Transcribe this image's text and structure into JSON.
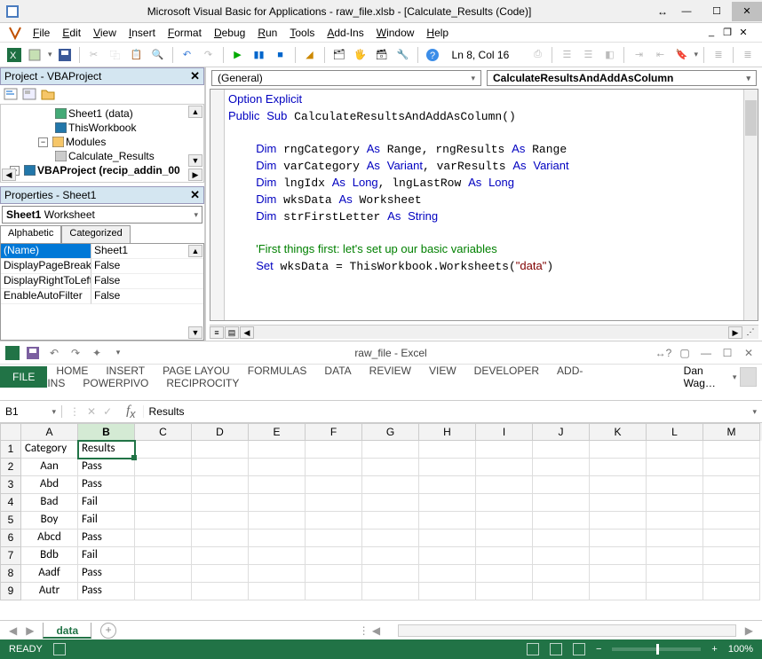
{
  "vba": {
    "title": "Microsoft Visual Basic for Applications - raw_file.xlsb - [Calculate_Results (Code)]",
    "menu": [
      "File",
      "Edit",
      "View",
      "Insert",
      "Format",
      "Debug",
      "Run",
      "Tools",
      "Add-Ins",
      "Window",
      "Help"
    ],
    "cursor_pos": "Ln 8, Col 16",
    "project": {
      "title": "Project - VBAProject",
      "items": [
        {
          "label": "Sheet1 (data)",
          "indent": 2,
          "icon": "sheet"
        },
        {
          "label": "ThisWorkbook",
          "indent": 2,
          "icon": "workbook"
        },
        {
          "label": "Modules",
          "indent": 1,
          "icon": "folder",
          "expandable": true,
          "expanded": true
        },
        {
          "label": "Calculate_Results",
          "indent": 2,
          "icon": "module"
        },
        {
          "label": "VBAProject (recip_addin_00",
          "indent": 0,
          "icon": "project",
          "expandable": true,
          "expanded": false,
          "bold": true
        }
      ]
    },
    "properties": {
      "title": "Properties - Sheet1",
      "object": "Sheet1",
      "type": "Worksheet",
      "tabs": [
        "Alphabetic",
        "Categorized"
      ],
      "active_tab": 0,
      "rows": [
        {
          "k": "(Name)",
          "v": "Sheet1",
          "sel": true
        },
        {
          "k": "DisplayPageBreaks",
          "v": "False"
        },
        {
          "k": "DisplayRightToLeft",
          "v": "False"
        },
        {
          "k": "EnableAutoFilter",
          "v": "False"
        }
      ]
    },
    "code": {
      "object_combo": "(General)",
      "proc_combo": "CalculateResultsAndAddAsColumn",
      "lines": [
        {
          "t": "Option Explicit",
          "k": [
            0,
            15
          ]
        },
        {
          "raw": "<span class=\"kw\">Public</span> <span class=\"kw\">Sub</span> CalculateResultsAndAddAsColumn()"
        },
        {
          "t": ""
        },
        {
          "raw": "    <span class=\"kw\">Dim</span> rngCategory <span class=\"kw\">As</span> Range, rngResults <span class=\"kw\">As</span> Range"
        },
        {
          "raw": "    <span class=\"kw\">Dim</span> varCategory <span class=\"kw\">As</span> <span class=\"kw\">Variant</span>, varResults <span class=\"kw\">As</span> <span class=\"kw\">Variant</span>"
        },
        {
          "raw": "    <span class=\"kw\">Dim</span> lngIdx <span class=\"kw\">As</span> <span class=\"kw\">Long</span>, lngLastRow <span class=\"kw\">As</span> <span class=\"kw\">Long</span>"
        },
        {
          "raw": "    <span class=\"kw\">Dim</span> wksData <span class=\"kw\">As</span> Worksheet"
        },
        {
          "raw": "    <span class=\"kw\">Dim</span> strFirstLetter <span class=\"kw\">As</span> <span class=\"kw\">String</span>"
        },
        {
          "t": ""
        },
        {
          "raw": "    <span class=\"cm\">'First things first: let's set up our basic variables</span>"
        },
        {
          "raw": "    <span class=\"kw\">Set</span> wksData = ThisWorkbook.Worksheets(<span class=\"str\">\"data\"</span>)"
        }
      ]
    }
  },
  "excel": {
    "qat_title": "raw_file - Excel",
    "tabs": [
      "HOME",
      "INSERT",
      "PAGE LAYOU",
      "FORMULAS",
      "DATA",
      "REVIEW",
      "VIEW",
      "DEVELOPER",
      "ADD-INS",
      "POWERPIVO",
      "RECIPROCITY"
    ],
    "file_label": "FILE",
    "user": "Dan Wag…",
    "name_box": "B1",
    "formula_bar": "Results",
    "columns": [
      "A",
      "B",
      "C",
      "D",
      "E",
      "F",
      "G",
      "H",
      "I",
      "J",
      "K",
      "L",
      "M"
    ],
    "selected_col": 1,
    "selected_cell": {
      "r": 0,
      "c": 1
    },
    "rows": [
      [
        "Category",
        "Results",
        "",
        "",
        "",
        "",
        "",
        "",
        "",
        "",
        "",
        "",
        ""
      ],
      [
        "Aan",
        "Pass",
        "",
        "",
        "",
        "",
        "",
        "",
        "",
        "",
        "",
        "",
        ""
      ],
      [
        "Abd",
        "Pass",
        "",
        "",
        "",
        "",
        "",
        "",
        "",
        "",
        "",
        "",
        ""
      ],
      [
        "Bad",
        "Fail",
        "",
        "",
        "",
        "",
        "",
        "",
        "",
        "",
        "",
        "",
        ""
      ],
      [
        "Boy",
        "Fail",
        "",
        "",
        "",
        "",
        "",
        "",
        "",
        "",
        "",
        "",
        ""
      ],
      [
        "Abcd",
        "Pass",
        "",
        "",
        "",
        "",
        "",
        "",
        "",
        "",
        "",
        "",
        ""
      ],
      [
        "Bdb",
        "Fail",
        "",
        "",
        "",
        "",
        "",
        "",
        "",
        "",
        "",
        "",
        ""
      ],
      [
        "Aadf",
        "Pass",
        "",
        "",
        "",
        "",
        "",
        "",
        "",
        "",
        "",
        "",
        ""
      ],
      [
        "Autr",
        "Pass",
        "",
        "",
        "",
        "",
        "",
        "",
        "",
        "",
        "",
        "",
        ""
      ]
    ],
    "sheet_tab": "data",
    "status": "READY",
    "zoom": "100%"
  }
}
